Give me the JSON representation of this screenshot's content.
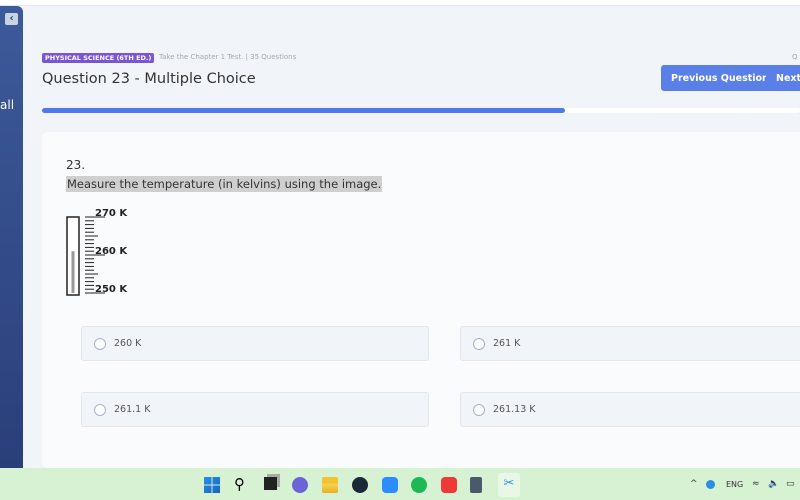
{
  "sidebar": {
    "partial_label": "all"
  },
  "header": {
    "course_badge": "PHYSICAL SCIENCE (6TH ED.)",
    "subtitle": "Take the Chapter 1 Test. | 35 Questions",
    "corner_text": "Q",
    "title": "Question 23 - Multiple Choice",
    "prev_label": "Previous Question",
    "next_label": "Next Q"
  },
  "progress": {
    "current": 23,
    "total": 35
  },
  "question": {
    "number": "23.",
    "text": "Measure the temperature (in kelvins) using the image.",
    "thermometer": {
      "labels": [
        "270 K",
        "260 K",
        "250 K"
      ],
      "min": 250,
      "max": 270,
      "reading": 261
    }
  },
  "options": [
    {
      "label": "260 K"
    },
    {
      "label": "261 K"
    },
    {
      "label": "261.1 K"
    },
    {
      "label": "261.13 K"
    }
  ],
  "taskbar": {
    "apps": [
      "windows-start",
      "search",
      "task-view",
      "teams-chat",
      "file-explorer",
      "steam",
      "zoom",
      "spotify",
      "vivaldi",
      "calculator",
      "snipping-tool"
    ],
    "language": "ENG"
  },
  "colors": {
    "accent": "#5b7fe9",
    "badge": "#7b55d6",
    "sidebar": "#2a3f7a",
    "taskbar": "#d6f2d3"
  }
}
